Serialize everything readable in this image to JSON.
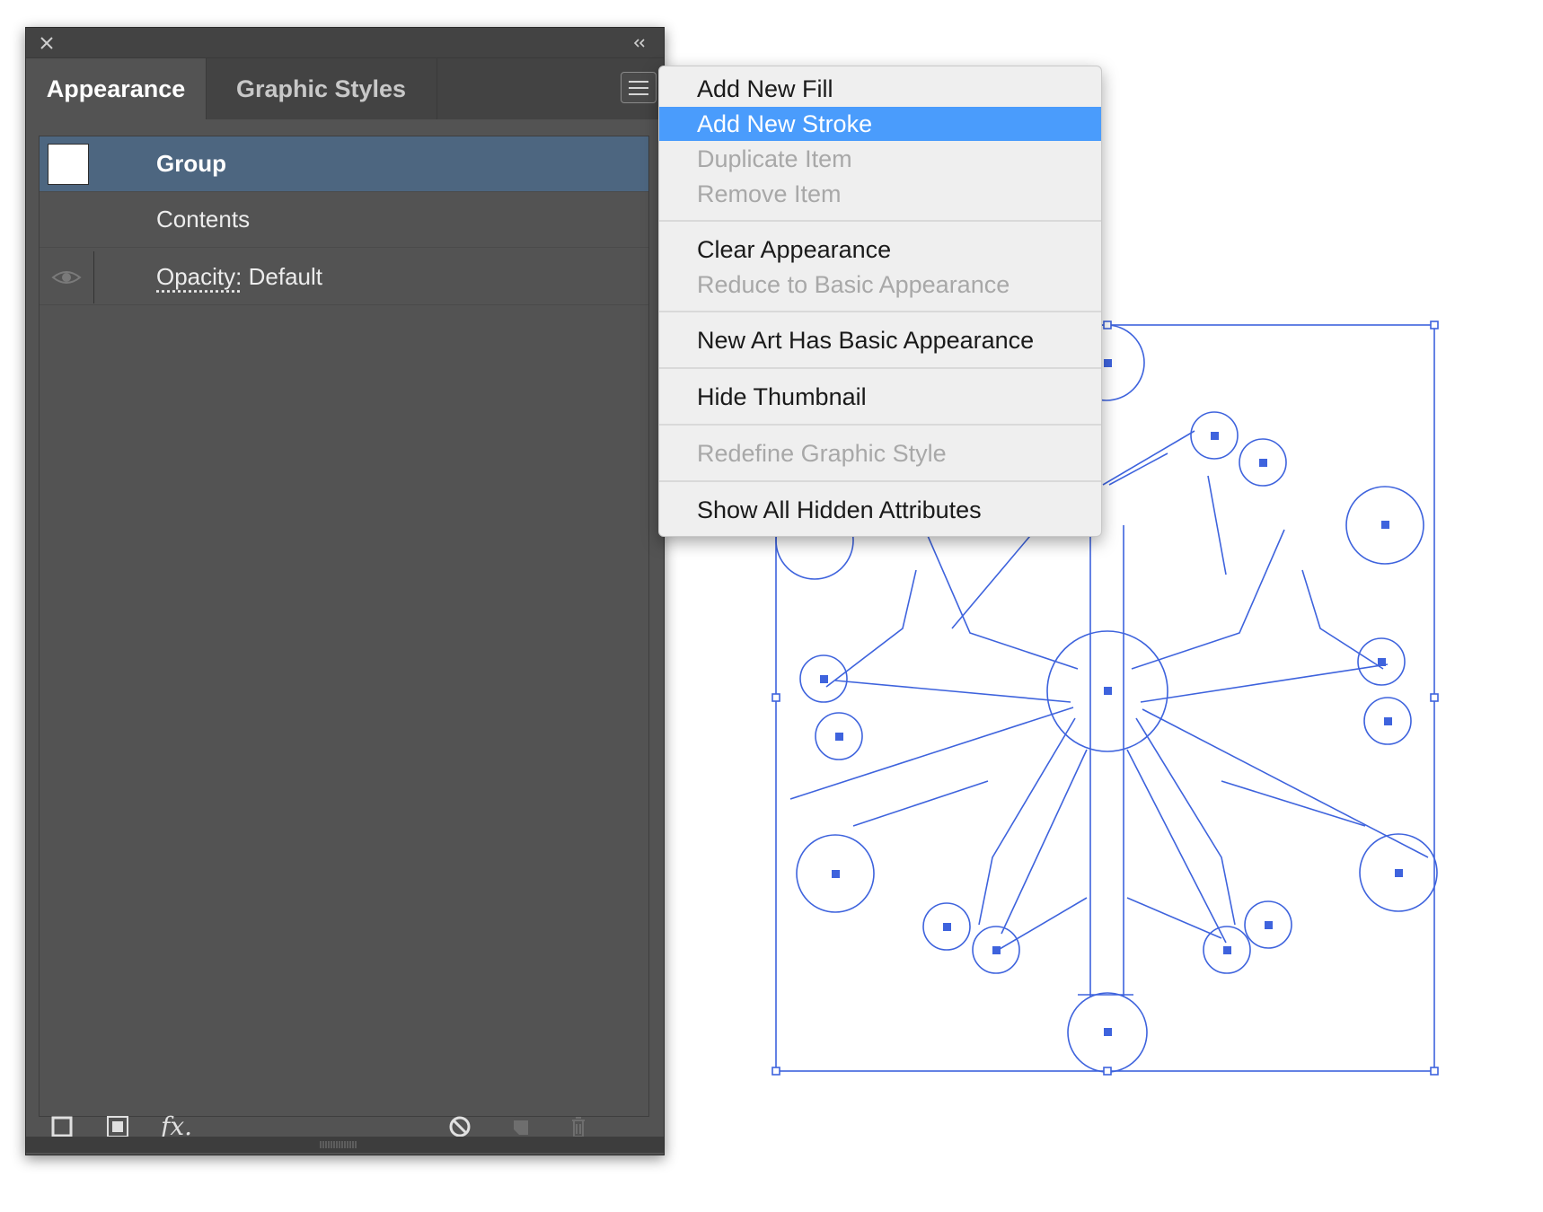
{
  "panel": {
    "tabs": [
      {
        "label": "Appearance",
        "active": true
      },
      {
        "label": "Graphic Styles",
        "active": false
      }
    ],
    "rows": {
      "group": "Group",
      "contents": "Contents",
      "opacity_label": "Opacity:",
      "opacity_value": "Default"
    },
    "bottom_icons": [
      "add-new-stroke-icon",
      "add-new-fill-icon",
      "fx-icon",
      "clear-appearance-icon",
      "duplicate-item-icon",
      "delete-item-icon"
    ],
    "fx_label": "fx."
  },
  "flyout_menu": {
    "items": [
      {
        "label": "Add New Fill",
        "state": "enabled"
      },
      {
        "label": "Add New Stroke",
        "state": "highlighted"
      },
      {
        "label": "Duplicate Item",
        "state": "disabled"
      },
      {
        "label": "Remove Item",
        "state": "disabled"
      },
      {
        "label": "Clear Appearance",
        "state": "enabled"
      },
      {
        "label": "Reduce to Basic Appearance",
        "state": "disabled"
      },
      {
        "label": "New Art Has Basic Appearance",
        "state": "enabled"
      },
      {
        "label": "Hide Thumbnail",
        "state": "enabled"
      },
      {
        "label": "Redefine Graphic Style",
        "state": "disabled"
      },
      {
        "label": "Show All Hidden Attributes",
        "state": "enabled"
      }
    ]
  },
  "colors": {
    "panel_bg": "#535353",
    "selected_row": "#4d6680",
    "menu_highlight": "#4a9cfc",
    "selection_blue": "#3e63dd"
  }
}
